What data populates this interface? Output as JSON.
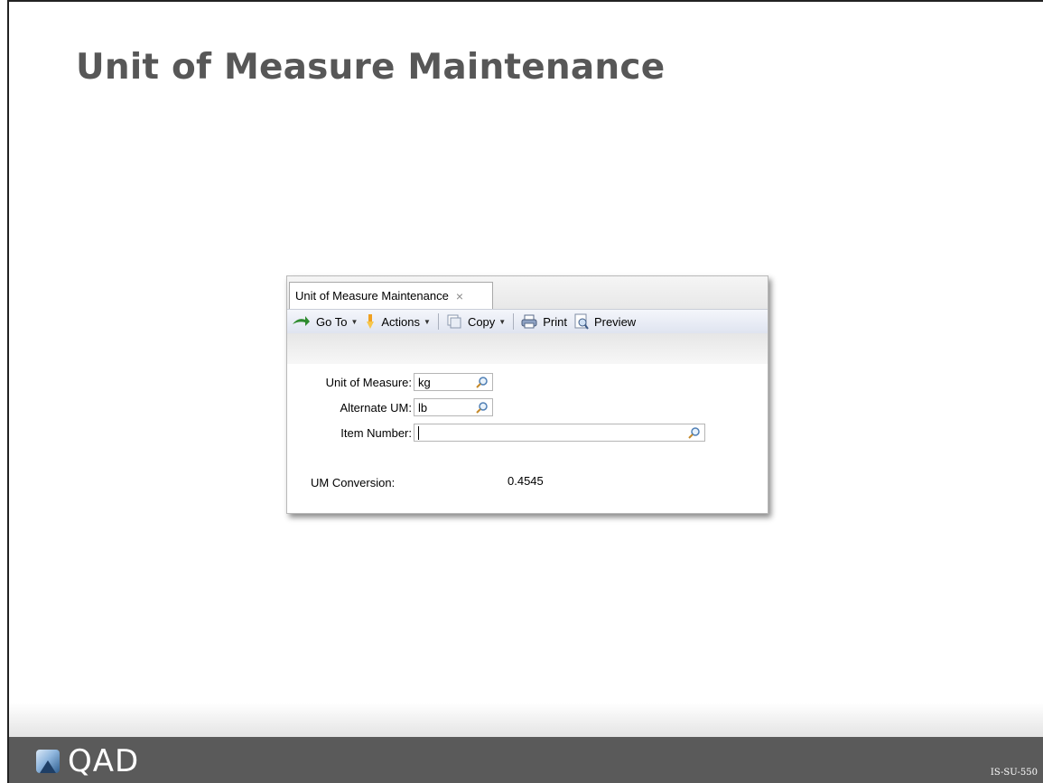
{
  "slide": {
    "title": "Unit of Measure Maintenance",
    "code": "IS-SU-550",
    "logo_text": "QAD"
  },
  "window": {
    "tab_label": "Unit of Measure Maintenance",
    "tab_close_glyph": "×",
    "toolbar": {
      "goto_label": "Go To",
      "actions_label": "Actions",
      "copy_label": "Copy",
      "print_label": "Print",
      "preview_label": "Preview"
    },
    "form": {
      "uom_label": "Unit of Measure:",
      "uom_value": "kg",
      "alt_label": "Alternate UM:",
      "alt_value": "lb",
      "item_label": "Item Number:",
      "item_value": "",
      "conversion_label": "UM Conversion:",
      "conversion_value": "0.4545"
    }
  },
  "icons": [
    "goto-arrow-icon",
    "actions-icon",
    "copy-icon",
    "print-icon",
    "preview-icon",
    "magnifier-icon"
  ],
  "colors": {
    "footer": "#5a5a5a",
    "title": "#575757",
    "toolbar_top": "#f4f6fb",
    "toolbar_bottom": "#dfe4f0"
  }
}
